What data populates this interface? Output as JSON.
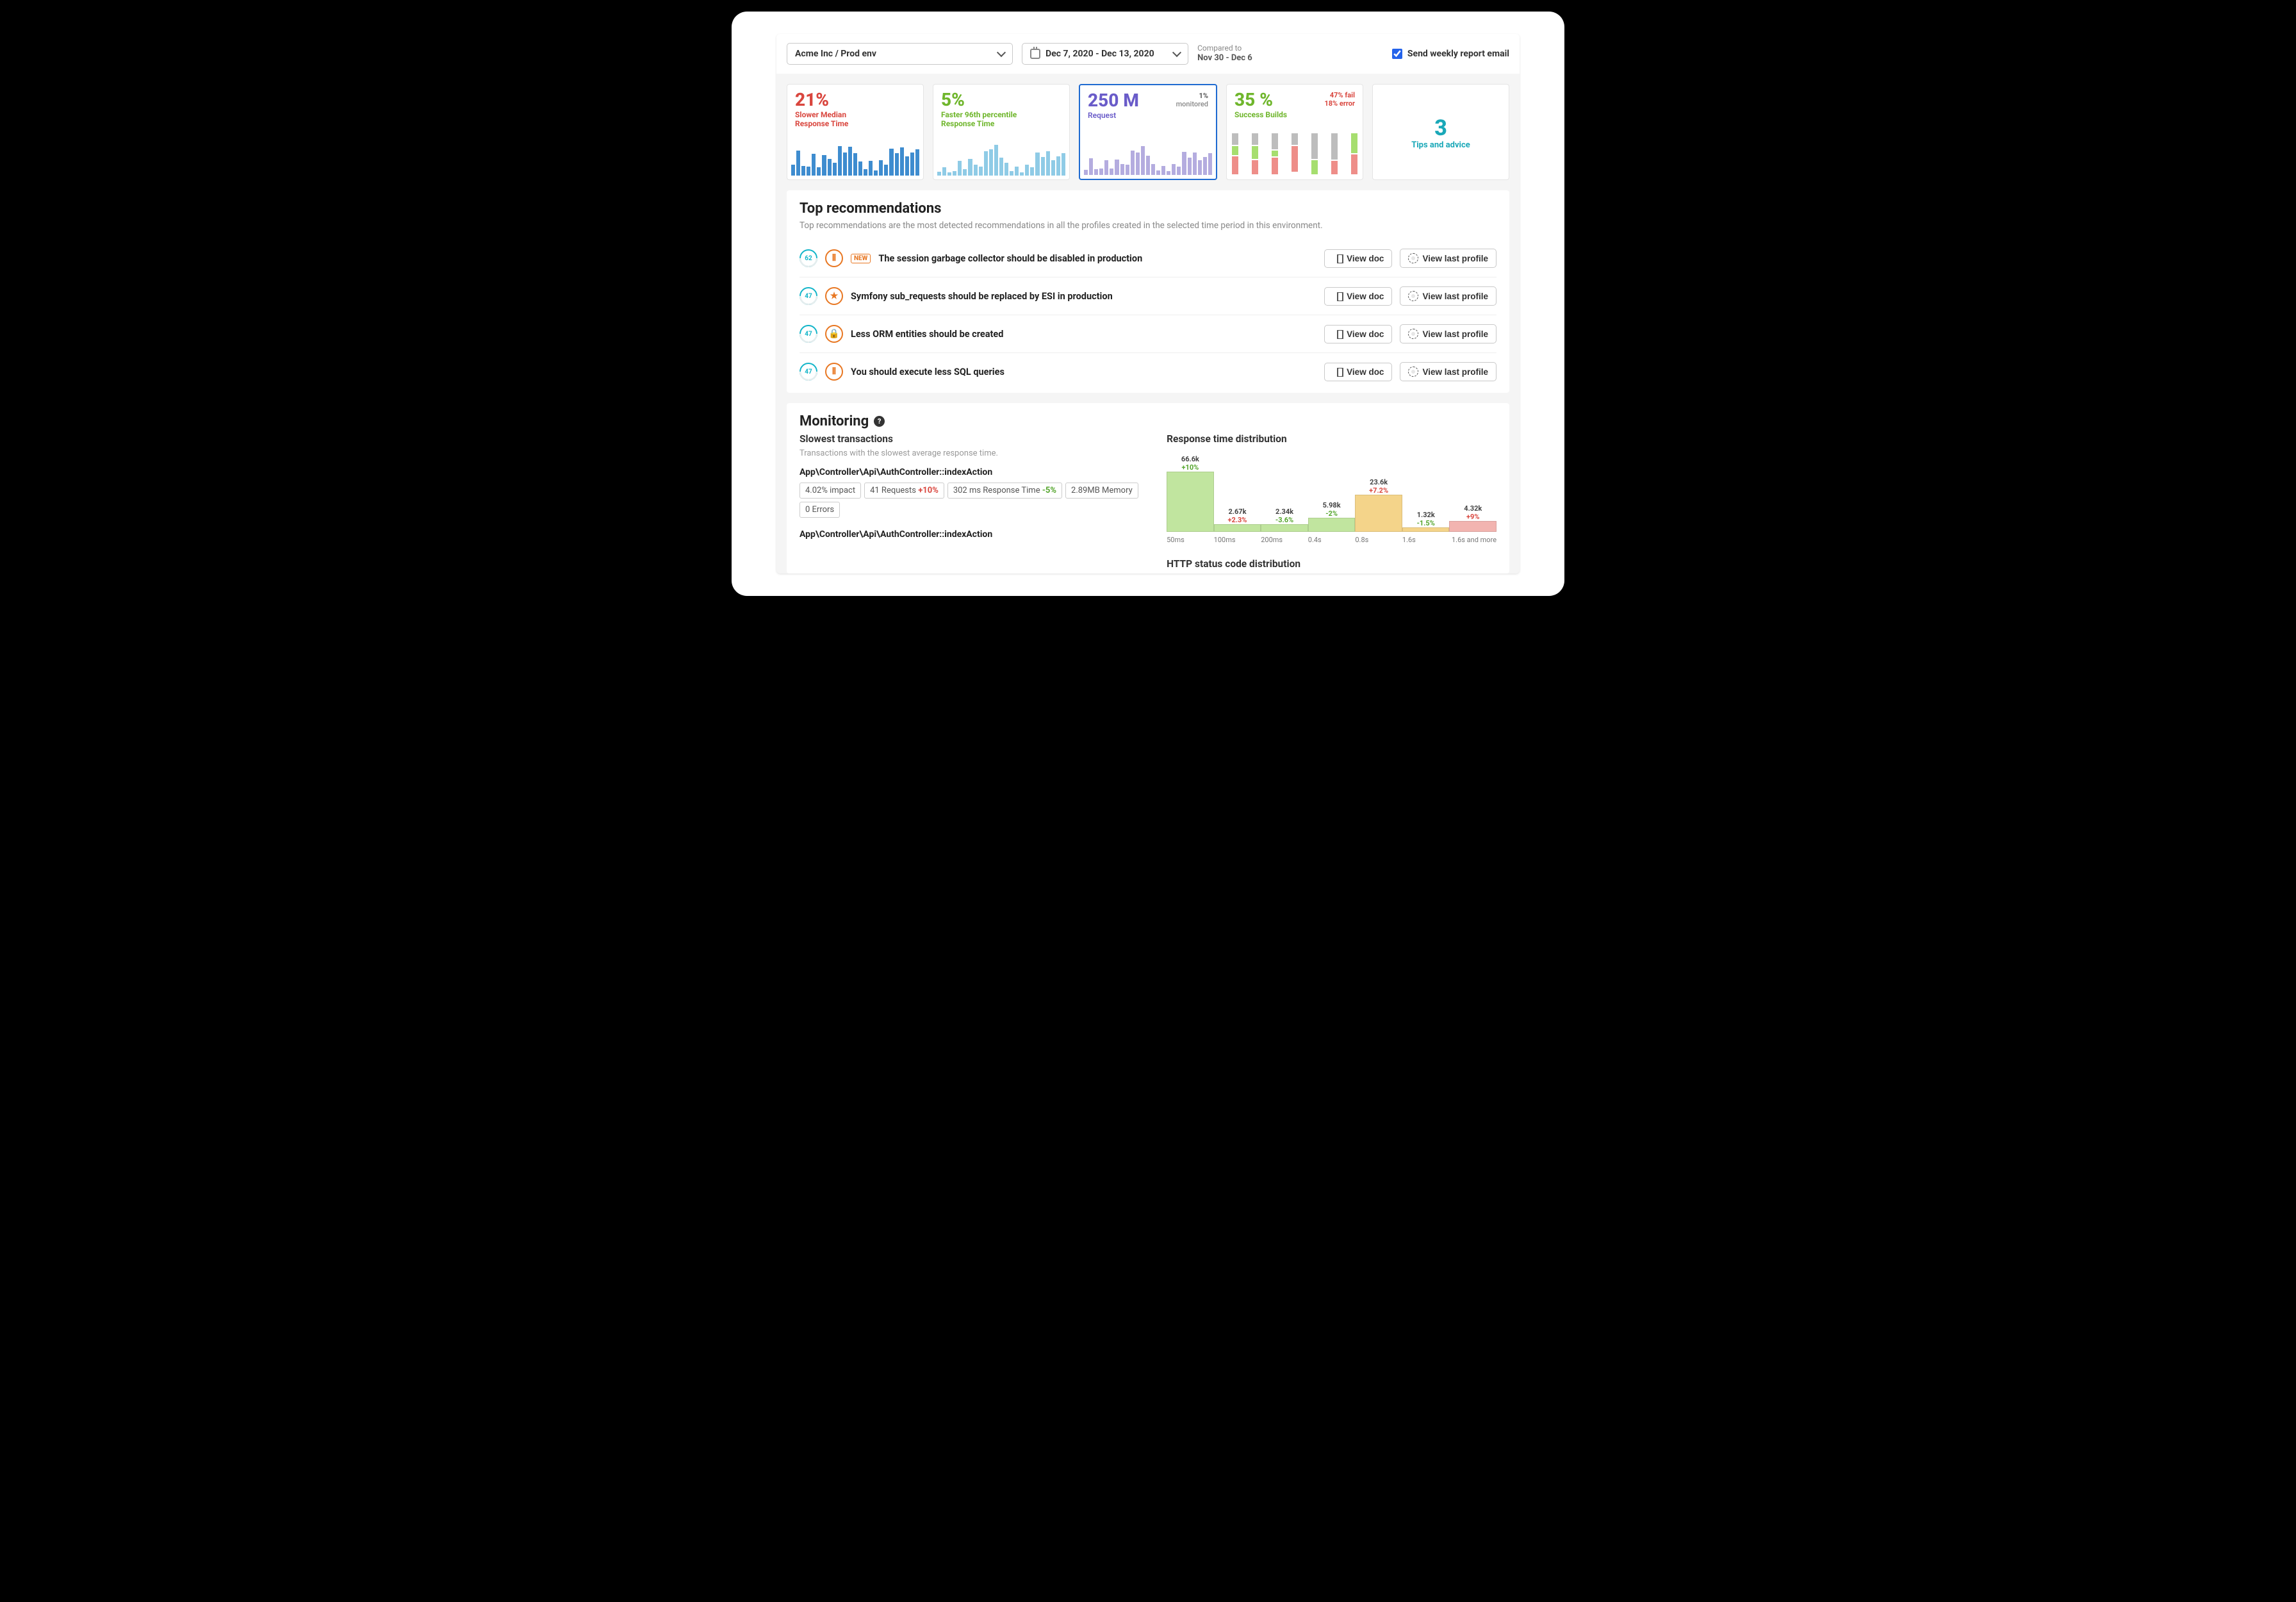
{
  "topbar": {
    "envLabel": "Acme Inc / Prod env",
    "dateLabel": "Dec 7, 2020 - Dec 13, 2020",
    "comparedLabel": "Compared to",
    "comparedRange": "Nov 30 - Dec 6",
    "weeklyLabel": "Send weekly report email",
    "weeklyChecked": true
  },
  "kpis": [
    {
      "variant": "blue",
      "big": "21%",
      "lbl": "Slower Median\nResponse Time",
      "spark": [
        30,
        68,
        26,
        24,
        58,
        22,
        55,
        44,
        34,
        80,
        62,
        78,
        60,
        38,
        18,
        40,
        14,
        42,
        30,
        72,
        60,
        76,
        52,
        62,
        70
      ]
    },
    {
      "variant": "teal",
      "big": "5%",
      "lbl": "Faster 96th percentile\nResponse Time",
      "spark": [
        10,
        22,
        8,
        12,
        40,
        18,
        44,
        30,
        24,
        66,
        70,
        82,
        48,
        34,
        12,
        24,
        8,
        30,
        22,
        62,
        50,
        66,
        42,
        52,
        60
      ]
    },
    {
      "variant": "purple",
      "big": "250 M",
      "lbl": "Request",
      "statTop": "1%",
      "statBottom": "monitored",
      "selected": true,
      "spark": [
        14,
        44,
        16,
        18,
        40,
        18,
        42,
        30,
        28,
        66,
        60,
        78,
        52,
        30,
        12,
        24,
        10,
        30,
        22,
        62,
        46,
        60,
        40,
        48,
        58
      ]
    },
    {
      "variant": "builds",
      "big": "35 %",
      "lbl": "Success Builds",
      "failTxt": "47% fail",
      "errTxt": "18% error",
      "cols": [
        [
          {
            "c": "#bdbdbd",
            "h": 18
          },
          {
            "c": "#a6de6f",
            "h": 14
          },
          {
            "c": "#ee8e89",
            "h": 28
          }
        ],
        [
          {
            "c": "#bdbdbd",
            "h": 18
          },
          {
            "c": "#a6de6f",
            "h": 20
          },
          {
            "c": "#ee8e89",
            "h": 22
          }
        ],
        [
          {
            "c": "#bdbdbd",
            "h": 28
          },
          {
            "c": "#a6de6f",
            "h": 10
          },
          {
            "c": "#ee8e89",
            "h": 30
          }
        ],
        [
          {
            "c": "#bdbdbd",
            "h": 18
          },
          {
            "c": "#ee8e89",
            "h": 40
          }
        ],
        [
          {
            "c": "#bdbdbd",
            "h": 44
          },
          {
            "c": "#a6de6f",
            "h": 24
          }
        ],
        [
          {
            "c": "#bdbdbd",
            "h": 44
          },
          {
            "c": "#ee8e89",
            "h": 22
          }
        ],
        [
          {
            "c": "#a6de6f",
            "h": 32
          },
          {
            "c": "#ee8e89",
            "h": 32
          }
        ]
      ]
    },
    {
      "variant": "tips",
      "big": "3",
      "lbl": "Tips and advice"
    }
  ],
  "recs": {
    "title": "Top recommendations",
    "sub": "Top recommendations are the most detected recommendations in all the profiles created in the selected time period in this environment.",
    "viewDocLabel": "View doc",
    "viewProfileLabel": "View last profile",
    "items": [
      {
        "count": "62",
        "icon": "bars",
        "new": true,
        "title": "The session garbage collector should be disabled in production"
      },
      {
        "count": "47",
        "icon": "star",
        "new": false,
        "title": "Symfony sub_requests should be replaced by ESI in production"
      },
      {
        "count": "47",
        "icon": "lock",
        "new": false,
        "title": "Less ORM entities should be created"
      },
      {
        "count": "47",
        "icon": "bars",
        "new": false,
        "title": "You should execute less SQL queries"
      }
    ],
    "newLabel": "NEW"
  },
  "monitoring": {
    "title": "Monitoring",
    "slowest": {
      "heading": "Slowest transactions",
      "hint": "Transactions with the slowest average response time.",
      "transactions": [
        {
          "title": "App\\Controller\\Api\\AuthController::indexAction",
          "chips": [
            {
              "text": "4.02% impact"
            },
            {
              "text": "41 Requests",
              "delta": "+10%",
              "deltaClass": "r"
            },
            {
              "text": "302 ms Response Time",
              "delta": "-5%",
              "deltaClass": "g"
            },
            {
              "text": "2.89MB Memory"
            },
            {
              "text": "0 Errors"
            }
          ]
        },
        {
          "title": "App\\Controller\\Api\\AuthController::indexAction",
          "chips": []
        }
      ]
    },
    "dist": {
      "heading": "Response time distribution",
      "bars": [
        {
          "v": "66.6k",
          "d": "+10%",
          "dc": "g",
          "h": 92,
          "c": "#c1e59f"
        },
        {
          "v": "2.67k",
          "d": "+2.3%",
          "dc": "r",
          "h": 10,
          "c": "#c1e59f"
        },
        {
          "v": "2.34k",
          "d": "-3.6%",
          "dc": "g",
          "h": 10,
          "c": "#c1e59f"
        },
        {
          "v": "5.98k",
          "d": "-2%",
          "dc": "g",
          "h": 18,
          "c": "#c1e59f"
        },
        {
          "v": "23.6k",
          "d": "+7.2%",
          "dc": "r",
          "h": 48,
          "c": "#f4d48a"
        },
        {
          "v": "1.32k",
          "d": "-1.5%",
          "dc": "g",
          "h": 6,
          "c": "#f4d48a"
        },
        {
          "v": "4.32k",
          "d": "+9%",
          "dc": "r",
          "h": 14,
          "c": "#f2b4b0"
        }
      ],
      "axis": [
        "50ms",
        "100ms",
        "200ms",
        "0.4s",
        "0.8s",
        "1.6s",
        "1.6s and more"
      ]
    },
    "httpHeading": "HTTP status code distribution"
  },
  "chart_data": {
    "type": "bar",
    "title": "Response time distribution",
    "xlabel": "",
    "ylabel": "",
    "categories": [
      "50ms",
      "100ms",
      "200ms",
      "0.4s",
      "0.8s",
      "1.6s",
      "1.6s and more"
    ],
    "series": [
      {
        "name": "count",
        "values": [
          66600,
          2670,
          2340,
          5980,
          23600,
          1320,
          4320
        ]
      },
      {
        "name": "delta_pct",
        "values": [
          10,
          2.3,
          -3.6,
          -2,
          7.2,
          -1.5,
          9
        ]
      }
    ]
  }
}
